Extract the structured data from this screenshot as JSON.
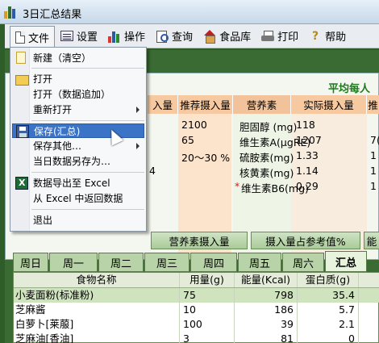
{
  "window": {
    "title": "3日汇总结果"
  },
  "menubar": [
    {
      "label": "文件",
      "icon": "file-icon"
    },
    {
      "label": "设置",
      "icon": "settings-icon"
    },
    {
      "label": "操作",
      "icon": "chart-icon"
    },
    {
      "label": "查询",
      "icon": "search-icon"
    },
    {
      "label": "食品库",
      "icon": "house-icon"
    },
    {
      "label": "打印",
      "icon": "printer-icon"
    },
    {
      "label": "帮助",
      "icon": "help-icon"
    }
  ],
  "file_menu": {
    "items": [
      {
        "label": "新建（清空）",
        "icon": "new-icon"
      },
      {
        "label": "打开",
        "icon": "open-folder-icon"
      },
      {
        "label": "打开（数据追加）"
      },
      {
        "label": "重新打开",
        "submenu": true
      },
      {
        "label": "保存(汇总)",
        "icon": "save-icon",
        "highlighted": true
      },
      {
        "label": "保存其他…",
        "submenu": true
      },
      {
        "label": "当日数据另存为…"
      },
      {
        "label": "数据导出至 Excel",
        "icon": "excel-icon"
      },
      {
        "label": "从 Excel 中返回数据"
      },
      {
        "label": "退出"
      }
    ]
  },
  "summary": {
    "title": "平均每人",
    "headers": {
      "actual_partial": "入量",
      "recommended": "推荐摄入量",
      "nutrient": "营养素",
      "actual": "实际摄入量",
      "rec2_partial": "推"
    },
    "left_recommended": [
      "2100",
      "65",
      "20～30 %"
    ],
    "left_partial_digit": "4",
    "nutrients": [
      {
        "name": "胆固醇 (mg)",
        "value": "118"
      },
      {
        "name": "维生素A(μgRE)",
        "value": "1207",
        "rec_partial": "7("
      },
      {
        "name": "硫胺素(mg)",
        "value": "1.33",
        "rec_partial": "1"
      },
      {
        "name": "核黄素(mg)",
        "value": "1.14",
        "rec_partial": "1"
      },
      {
        "name": "维生素B6(mg)",
        "value": "0.29",
        "rec_partial": "1",
        "star": "*"
      }
    ],
    "subtabs": [
      "营养素摄入量",
      "摄入量占参考值%",
      "能"
    ]
  },
  "day_tabs": [
    "周日",
    "周一",
    "周二",
    "周三",
    "周四",
    "周五",
    "周六",
    "汇总"
  ],
  "active_day_tab": "汇总",
  "food_table": {
    "columns": [
      "食物名称",
      "用量(g)",
      "能量(Kcal)",
      "蛋白质(g)"
    ],
    "rows": [
      {
        "name": "小麦面粉(标准粉)",
        "amount": "75",
        "energy": "798",
        "protein": "35.4"
      },
      {
        "name": "芝麻酱",
        "amount": "10",
        "energy": "186",
        "protein": "5.7"
      },
      {
        "name": "白萝卜[莱菔]",
        "amount": "100",
        "energy": "39",
        "protein": "2.1"
      },
      {
        "name": "芝麻油[香油]",
        "amount": "3",
        "energy": "81",
        "protein": "0"
      }
    ]
  }
}
